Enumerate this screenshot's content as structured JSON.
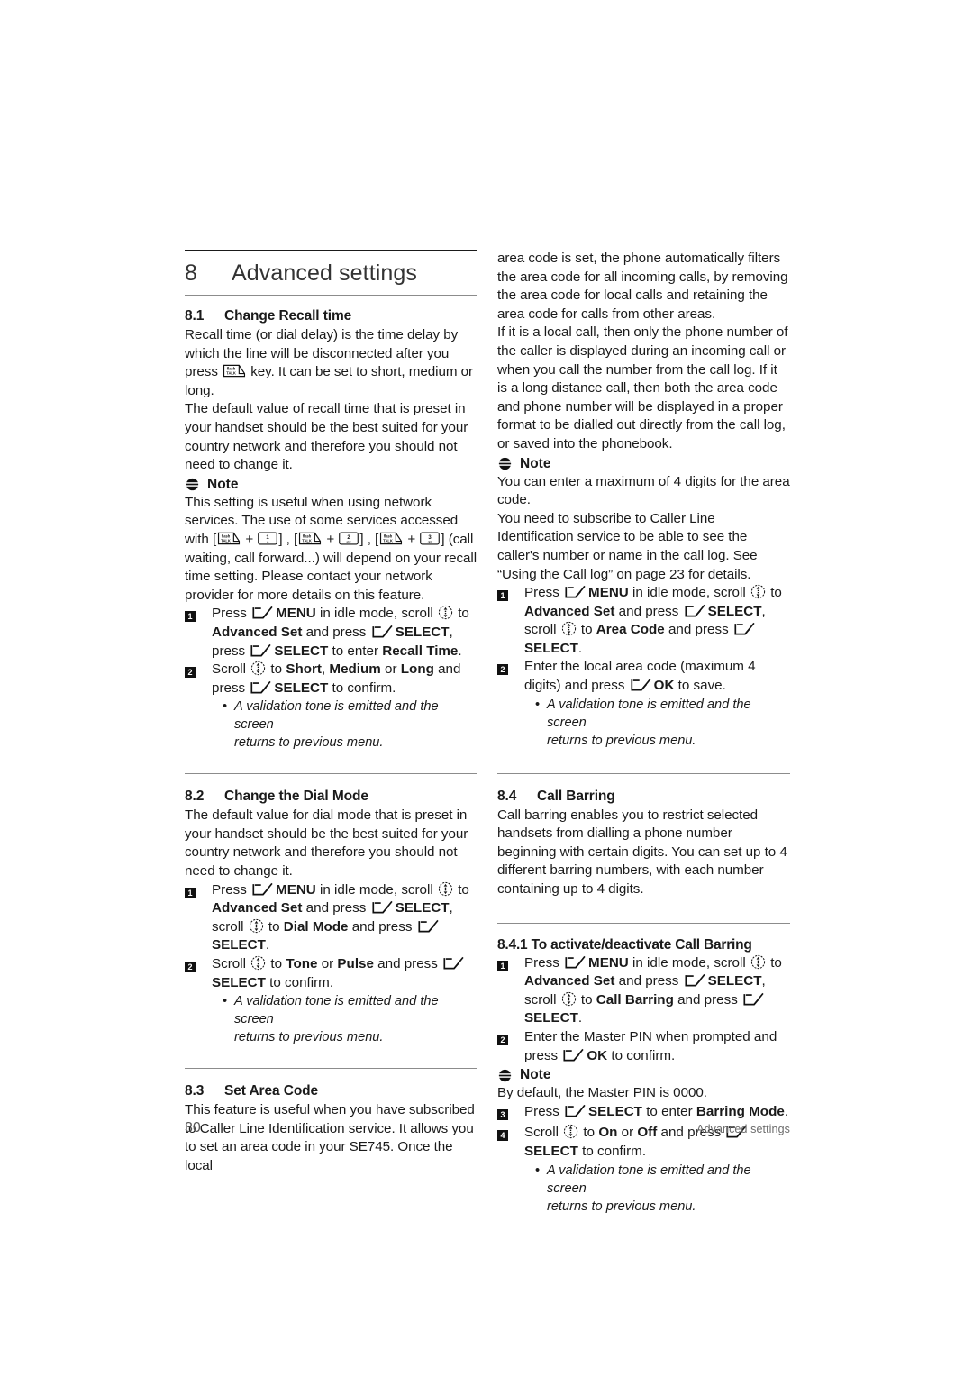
{
  "chapter": {
    "number": "8",
    "title": "Advanced settings"
  },
  "footer": {
    "page_number": "30",
    "running_head": "Advanced settings"
  },
  "labels": {
    "note": "Note",
    "menu": "MENU",
    "select": "SELECT",
    "ok": "OK"
  },
  "icons": {
    "softkey": "softkey-icon",
    "scroll": "scroll-up-down-icon",
    "note": "note-icon",
    "flash_talk": "flash-talk-key-icon",
    "digit_1": "digit-1-key-icon",
    "digit_2": "digit-2-key-icon",
    "digit_3": "digit-3-key-icon",
    "step_badge": "step-number-badge"
  },
  "left_column": {
    "s81": {
      "number": "8.1",
      "title": "Change Recall time",
      "p1_a": "Recall time (or dial delay) is the time delay by which the line will be disconnected after you press ",
      "p1_b": " key. It can be set to short, medium or long.",
      "p2": "The default value of recall time that is preset in your handset should be the best suited for your country network and therefore you should not need to change it.",
      "note_a": "This setting is useful when using network services. The use of some services accessed with ",
      "note_b": " (call waiting, call forward...) will depend on your recall time setting. Please contact your network provider for more details on this feature.",
      "step1": {
        "num": "1",
        "t1": "Press ",
        "t2": " in idle mode, scroll ",
        "t3": " to ",
        "t4": "Advanced Set",
        "t5": " and press ",
        "t6": ", press ",
        "t7": " to enter ",
        "t8": "Recall Time",
        "t9": "."
      },
      "step2": {
        "num": "2",
        "t1": "Scroll ",
        "t2": " to ",
        "t3": "Short",
        "t4": ", ",
        "t5": "Medium",
        "t6": " or ",
        "t7": "Long",
        "t8": " and press ",
        "t9": " to confirm."
      },
      "bullet_line1": "A validation tone is emitted and the screen",
      "bullet_line2": "returns to previous menu."
    },
    "s82": {
      "number": "8.2",
      "title": "Change the Dial Mode",
      "p1": "The default value for dial mode that is preset in your handset should be the best suited for your country network and therefore you should not need to change it.",
      "step1": {
        "num": "1",
        "t1": "Press ",
        "t2": " in idle mode, scroll ",
        "t3": " to ",
        "t4": "Advanced Set",
        "t5": " and press ",
        "t6": ", scroll ",
        "t7": " to ",
        "t8": "Dial Mode",
        "t9": " and press ",
        "t10": "."
      },
      "step2": {
        "num": "2",
        "t1": "Scroll ",
        "t2": " to ",
        "t3": "Tone",
        "t4": " or ",
        "t5": "Pulse",
        "t6": " and press ",
        "t7": " to confirm."
      },
      "bullet_line1": "A validation tone is emitted and the screen",
      "bullet_line2": "returns to previous menu."
    },
    "s83": {
      "number": "8.3",
      "title": "Set Area Code",
      "p1": "This feature is useful when you have subscribed to Caller Line Identification service. It allows you to set an area code in your SE745. Once the local"
    }
  },
  "right_column": {
    "s83_cont": {
      "p1": "area code is set, the phone automatically filters the area code for all incoming calls, by removing the area code for local calls and retaining the area code for calls from other areas.",
      "p2": "If it is a local call, then only the phone number of the caller is displayed during an incoming call or when you call the number from the call log. If it is a long distance call, then both the area code and phone number will be displayed in a proper format to be dialled out directly from the call log, or saved into the phonebook.",
      "note1": "You can enter a maximum of 4 digits for the area code.",
      "note2": "You need to subscribe to Caller Line Identification service to be able to see the caller's number or name in the call log. See “Using the Call log” on page 23 for details.",
      "step1": {
        "num": "1",
        "t1": "Press ",
        "t2": " in idle mode, scroll ",
        "t3": " to ",
        "t4": "Advanced Set",
        "t5": " and press ",
        "t6": ", scroll ",
        "t7": " to ",
        "t8": "Area Code",
        "t9": " and press ",
        "t10": "."
      },
      "step2": {
        "num": "2",
        "t1": "Enter the local area code (maximum 4 digits) and press ",
        "t2": " to save."
      },
      "bullet_line1": "A validation tone is emitted and the screen",
      "bullet_line2": "returns to previous menu."
    },
    "s84": {
      "number": "8.4",
      "title": "Call Barring",
      "p1": "Call barring enables you to restrict selected handsets from dialling a phone number beginning with certain digits. You can set up to 4 different barring numbers, with each number containing up to 4 digits."
    },
    "s841": {
      "title": "8.4.1  To activate/deactivate Call Barring",
      "step1": {
        "num": "1",
        "t1": "Press ",
        "t2": " in idle mode, scroll ",
        "t3": " to ",
        "t4": "Advanced Set",
        "t5": " and press ",
        "t6": ", scroll ",
        "t7": " to ",
        "t8": "Call Barring",
        "t9": " and press ",
        "t10": "."
      },
      "step2": {
        "num": "2",
        "t1": "Enter the Master PIN when prompted and press ",
        "t2": " to confirm."
      },
      "note1": "By default, the Master PIN is 0000.",
      "step3": {
        "num": "3",
        "t1": "Press ",
        "t2": " to enter ",
        "t3": "Barring Mode",
        "t4": "."
      },
      "step4": {
        "num": "4",
        "t1": "Scroll ",
        "t2": " to ",
        "t3": "On",
        "t4": " or ",
        "t5": "Off",
        "t6": " and press ",
        "t7": " to confirm."
      },
      "bullet_line1": "A validation tone is emitted and the screen",
      "bullet_line2": "returns to previous menu."
    }
  },
  "colors": {
    "text": "#1a1a1a",
    "rule_thick": "#1a1a1a",
    "rule_thin": "#8c8c8c",
    "folio": "#555555"
  }
}
